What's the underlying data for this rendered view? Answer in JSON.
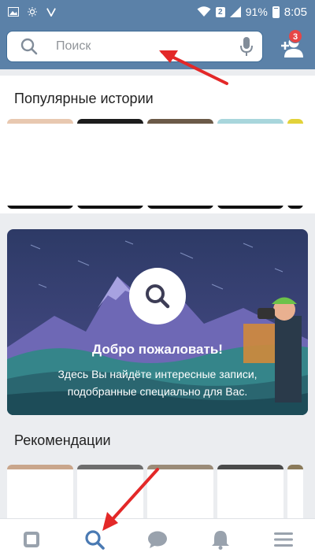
{
  "status_bar": {
    "battery": "91%",
    "time": "8:05",
    "sim": "2",
    "icons": [
      "image-icon",
      "brightness-icon",
      "vk-icon",
      "wifi-icon",
      "signal-icon",
      "battery-icon"
    ]
  },
  "header": {
    "search_placeholder": "Поиск",
    "friend_requests_badge": "3",
    "icons": [
      "search-icon",
      "mic-icon",
      "add-friend-icon"
    ]
  },
  "sections": {
    "stories_title": "Популярные истории",
    "welcome_title": "Добро пожаловать!",
    "welcome_text": "Здесь Вы найдёте интересные записи, подобранные специально для Вас.",
    "recommendations_title": "Рекомендации"
  },
  "bottom_nav": {
    "tabs": [
      "news-icon",
      "search-icon",
      "messages-icon",
      "notifications-icon",
      "menu-icon"
    ],
    "active": "search-icon"
  },
  "colors": {
    "accent": "#5b81a8",
    "active_tab": "#4a7ab3",
    "badge": "#e64646",
    "annotation_arrow": "#e32828"
  }
}
